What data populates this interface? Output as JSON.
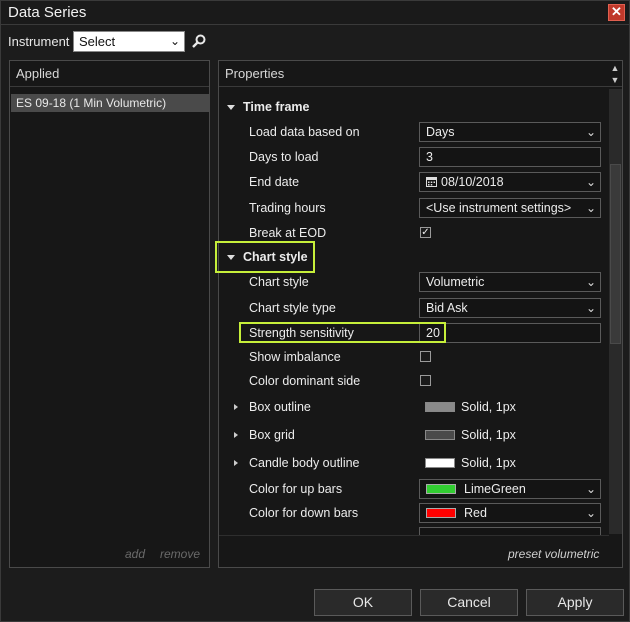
{
  "window": {
    "title": "Data Series"
  },
  "instrument": {
    "label": "Instrument",
    "value": "Select"
  },
  "applied": {
    "header": "Applied",
    "item": "ES 09-18 (1 Min Volumetric)",
    "add": "add",
    "remove": "remove"
  },
  "properties": {
    "header": "Properties",
    "footer_link": "preset volumetric",
    "sections": {
      "time_frame": "Time frame",
      "chart_style": "Chart style"
    },
    "rows": {
      "load_data": {
        "label": "Load data based on",
        "value": "Days"
      },
      "days_to_load": {
        "label": "Days to load",
        "value": "3"
      },
      "end_date": {
        "label": "End date",
        "value": "08/10/2018"
      },
      "trading_hours": {
        "label": "Trading hours",
        "value": "<Use instrument settings>"
      },
      "break_eod": {
        "label": "Break at EOD",
        "checked": true
      },
      "chart_style": {
        "label": "Chart style",
        "value": "Volumetric"
      },
      "chart_style_type": {
        "label": "Chart style type",
        "value": "Bid Ask"
      },
      "strength": {
        "label": "Strength sensitivity",
        "value": "20"
      },
      "show_imbalance": {
        "label": "Show imbalance",
        "checked": false
      },
      "color_dominant": {
        "label": "Color dominant side",
        "checked": false
      },
      "box_outline": {
        "label": "Box outline",
        "value": "Solid, 1px",
        "color": "#8a8a8a"
      },
      "box_grid": {
        "label": "Box grid",
        "value": "Solid, 1px",
        "color": "#4a4a4a"
      },
      "candle_outline": {
        "label": "Candle body outline",
        "value": "Solid, 1px",
        "color": "#ffffff"
      },
      "up_bars": {
        "label": "Color for up bars",
        "value": "LimeGreen",
        "color": "#32cd32"
      },
      "down_bars": {
        "label": "Color for down bars",
        "value": "Red",
        "color": "#ff0000"
      }
    }
  },
  "buttons": {
    "ok": "OK",
    "cancel": "Cancel",
    "apply": "Apply"
  },
  "colors": {
    "highlight": "#c6ef3a",
    "accent_close": "#c0392b"
  }
}
